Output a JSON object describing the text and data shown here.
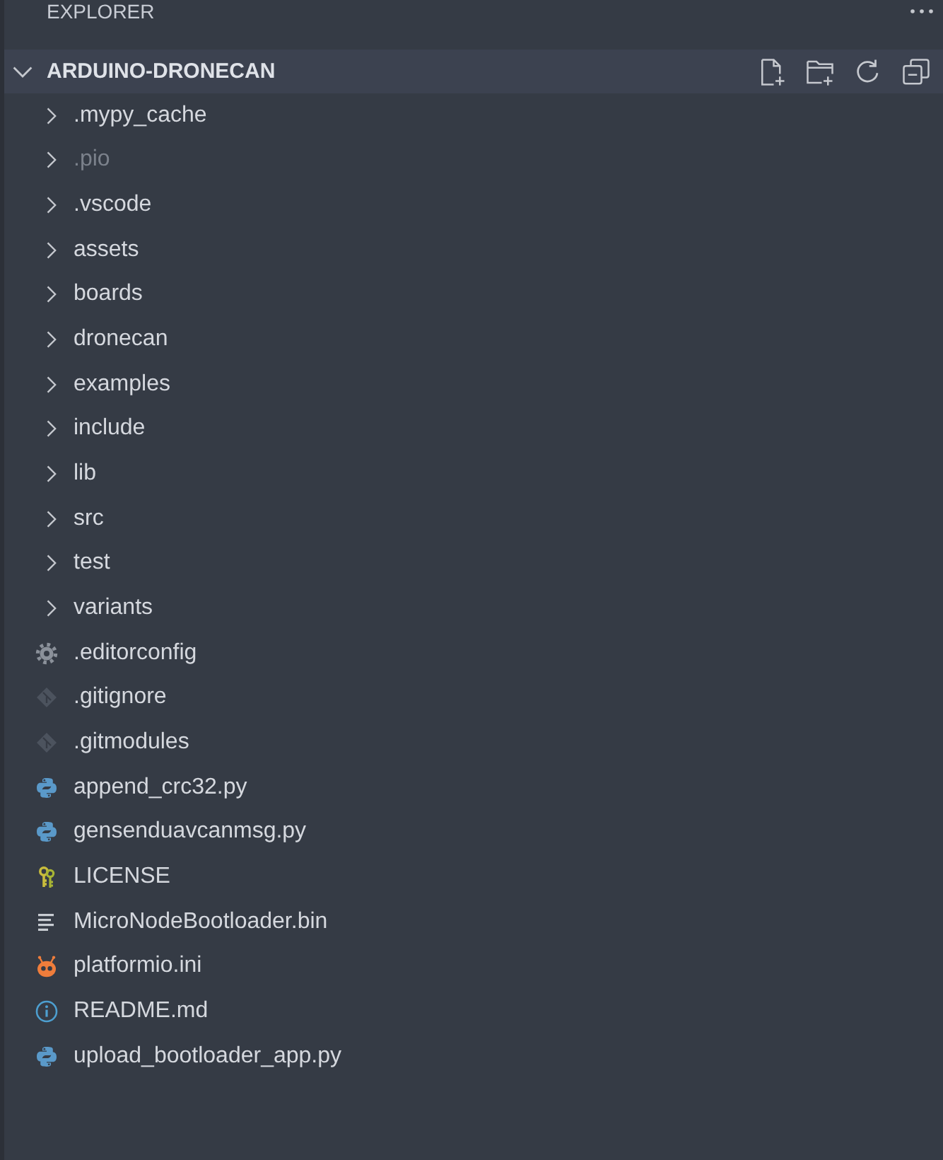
{
  "sidebar": {
    "title": "EXPLORER"
  },
  "folder": {
    "name": "ARDUINO-DRONECAN",
    "expanded": true,
    "children": [
      {
        "name": ".mypy_cache",
        "kind": "folder",
        "expanded": false,
        "ignored": false
      },
      {
        "name": ".pio",
        "kind": "folder",
        "expanded": false,
        "ignored": true
      },
      {
        "name": ".vscode",
        "kind": "folder",
        "expanded": false,
        "ignored": false
      },
      {
        "name": "assets",
        "kind": "folder",
        "expanded": false,
        "ignored": false
      },
      {
        "name": "boards",
        "kind": "folder",
        "expanded": false,
        "ignored": false
      },
      {
        "name": "dronecan",
        "kind": "folder",
        "expanded": false,
        "ignored": false
      },
      {
        "name": "examples",
        "kind": "folder",
        "expanded": false,
        "ignored": false
      },
      {
        "name": "include",
        "kind": "folder",
        "expanded": false,
        "ignored": false
      },
      {
        "name": "lib",
        "kind": "folder",
        "expanded": false,
        "ignored": false
      },
      {
        "name": "src",
        "kind": "folder",
        "expanded": false,
        "ignored": false
      },
      {
        "name": "test",
        "kind": "folder",
        "expanded": false,
        "ignored": false
      },
      {
        "name": "variants",
        "kind": "folder",
        "expanded": false,
        "ignored": false
      },
      {
        "name": ".editorconfig",
        "kind": "config",
        "ignored": false
      },
      {
        "name": ".gitignore",
        "kind": "git",
        "ignored": false
      },
      {
        "name": ".gitmodules",
        "kind": "git",
        "ignored": false
      },
      {
        "name": "append_crc32.py",
        "kind": "python",
        "ignored": false
      },
      {
        "name": "gensenduavcanmsg.py",
        "kind": "python",
        "ignored": false
      },
      {
        "name": "LICENSE",
        "kind": "license",
        "ignored": false
      },
      {
        "name": "MicroNodeBootloader.bin",
        "kind": "binary",
        "ignored": false
      },
      {
        "name": "platformio.ini",
        "kind": "platformio",
        "ignored": false
      },
      {
        "name": "README.md",
        "kind": "readme",
        "ignored": false
      },
      {
        "name": "upload_bootloader_app.py",
        "kind": "python",
        "ignored": false
      }
    ]
  }
}
